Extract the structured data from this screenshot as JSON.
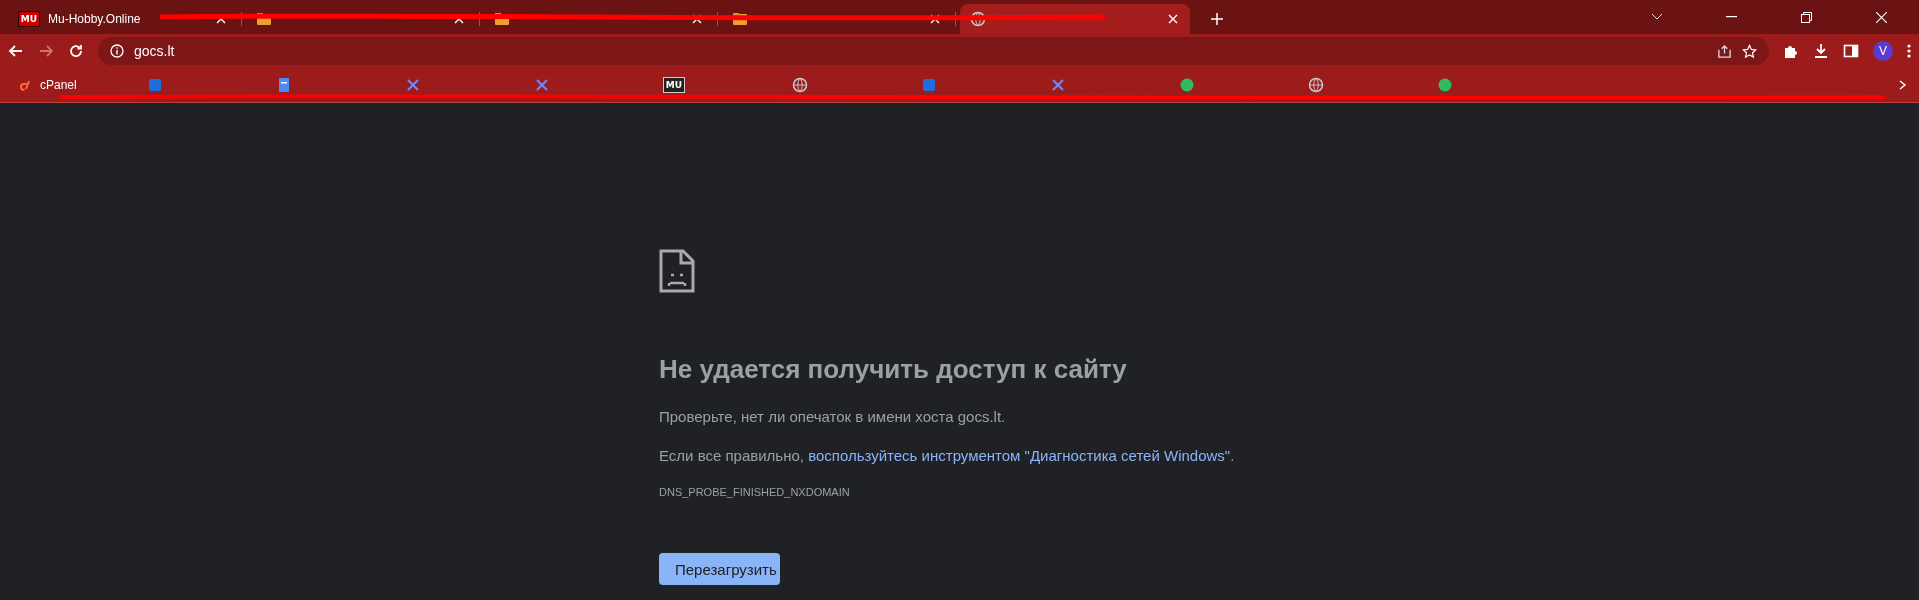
{
  "tabs": [
    {
      "kind": "logo",
      "badge": "MU",
      "title": "Mu-Hobby.Online",
      "selected": false
    },
    {
      "kind": "folder",
      "selected": false
    },
    {
      "kind": "folder",
      "selected": false
    },
    {
      "kind": "folder",
      "selected": false
    },
    {
      "kind": "globe",
      "selected": true
    }
  ],
  "toolbar": {
    "nav": [
      {
        "kind": "back",
        "disabled": false
      },
      {
        "kind": "forward",
        "disabled": true
      },
      {
        "kind": "reload",
        "disabled": false
      }
    ],
    "url": "gocs.lt",
    "avatar": "V"
  },
  "bookmarks": [
    {
      "kind": "cpanel",
      "title": "cPanel"
    },
    {
      "kind": "square"
    },
    {
      "kind": "doc"
    },
    {
      "kind": "cross"
    },
    {
      "kind": "cross"
    },
    {
      "kind": "logo",
      "badge": "MU"
    },
    {
      "kind": "globe"
    },
    {
      "kind": "square"
    },
    {
      "kind": "cross"
    },
    {
      "kind": "circle"
    },
    {
      "kind": "globe"
    },
    {
      "kind": "circle"
    }
  ],
  "error": {
    "heading": "Не удается получить доступ к сайту",
    "hint": "Проверьте, нет ли опечаток в имени хоста gocs.lt.",
    "suggestion_before": "Если все правильно, ",
    "suggestion_link": "воспользуйтесь инструментом \"Диагностика сетей Windows\"",
    "suggestion_after": ".",
    "code": "DNS_PROBE_FINISHED_NXDOMAIN",
    "button": "Перезагрузить"
  }
}
